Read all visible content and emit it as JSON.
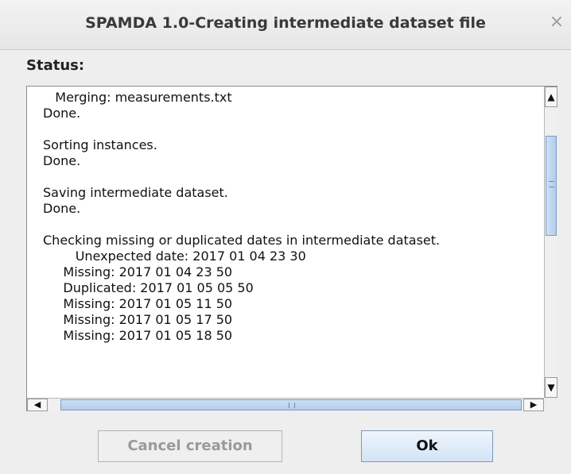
{
  "window": {
    "title": "SPAMDA 1.0-Creating intermediate dataset file",
    "close_symbol": "×"
  },
  "status": {
    "label": "Status:",
    "lines": [
      "   Merging: measurements.txt",
      "Done.",
      "",
      "Sorting instances.",
      "Done.",
      "",
      "Saving intermediate dataset.",
      "Done.",
      "",
      "Checking missing or duplicated dates in intermediate dataset.",
      "        Unexpected date: 2017 01 04 23 30",
      "     Missing: 2017 01 04 23 50",
      "     Duplicated: 2017 01 05 05 50",
      "     Missing: 2017 01 05 11 50",
      "     Missing: 2017 01 05 17 50",
      "     Missing: 2017 01 05 18 50"
    ]
  },
  "scrollbars": {
    "up_arrow": "▲",
    "down_arrow": "▼",
    "left_arrow": "◀",
    "right_arrow": "▶"
  },
  "buttons": {
    "cancel_label": "Cancel creation",
    "ok_label": "Ok"
  },
  "colors": {
    "accent": "#b4cdea",
    "window_bg": "#eeeeee"
  }
}
